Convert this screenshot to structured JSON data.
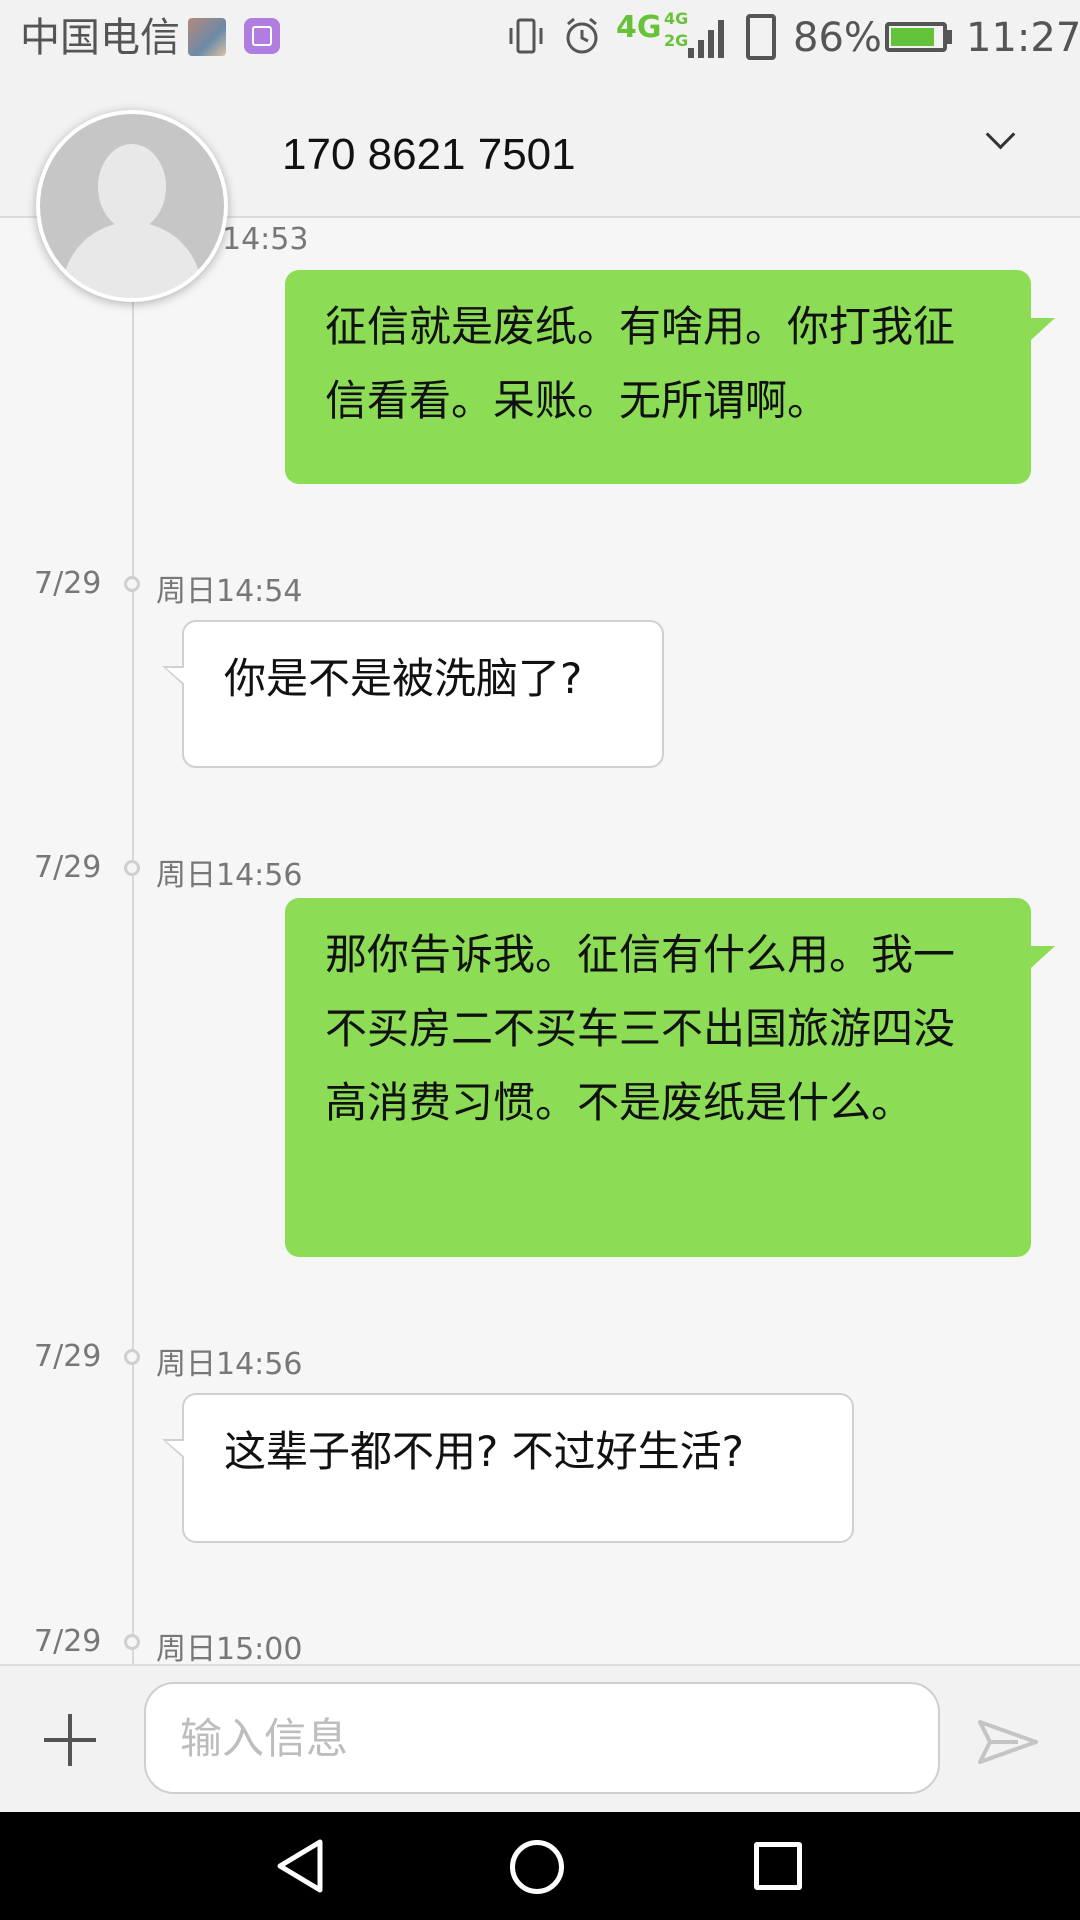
{
  "status_bar": {
    "carrier": "中国电信",
    "network_main": "4G",
    "network_secondary": "4G\n2G",
    "battery_percent": "86%",
    "battery_level": 0.86,
    "time": "11:27",
    "icons": [
      "photo-thumbnail-icon",
      "gallery-icon",
      "vibrate-icon",
      "alarm-icon",
      "signal-icon",
      "sim-card-icon",
      "battery-charging-icon"
    ]
  },
  "header": {
    "contact": "170 8621 7501",
    "expand_icon": "chevron-down-icon"
  },
  "messages": [
    {
      "direction": "outgoing",
      "date": "",
      "time": "14:53",
      "text": "征信就是废纸。有啥用。你打我征信看看。呆账。无所谓啊。"
    },
    {
      "direction": "incoming",
      "date": "7/29",
      "time": "周日14:54",
      "text": "你是不是被洗脑了?"
    },
    {
      "direction": "outgoing",
      "date": "7/29",
      "time": "周日14:56",
      "text": "那你告诉我。征信有什么用。我一不买房二不买车三不出国旅游四没高消费习惯。不是废纸是什么。"
    },
    {
      "direction": "incoming",
      "date": "7/29",
      "time": "周日14:56",
      "text": "这辈子都不用?  不过好生活?"
    },
    {
      "direction": "incoming",
      "date": "7/29",
      "time": "周日15:00",
      "text": ""
    }
  ],
  "composer": {
    "placeholder": "输入信息",
    "value": "",
    "add_icon": "plus-icon",
    "send_icon": "send-icon"
  },
  "navigation": {
    "icons": [
      "back-icon",
      "home-icon",
      "recent-apps-icon"
    ]
  }
}
